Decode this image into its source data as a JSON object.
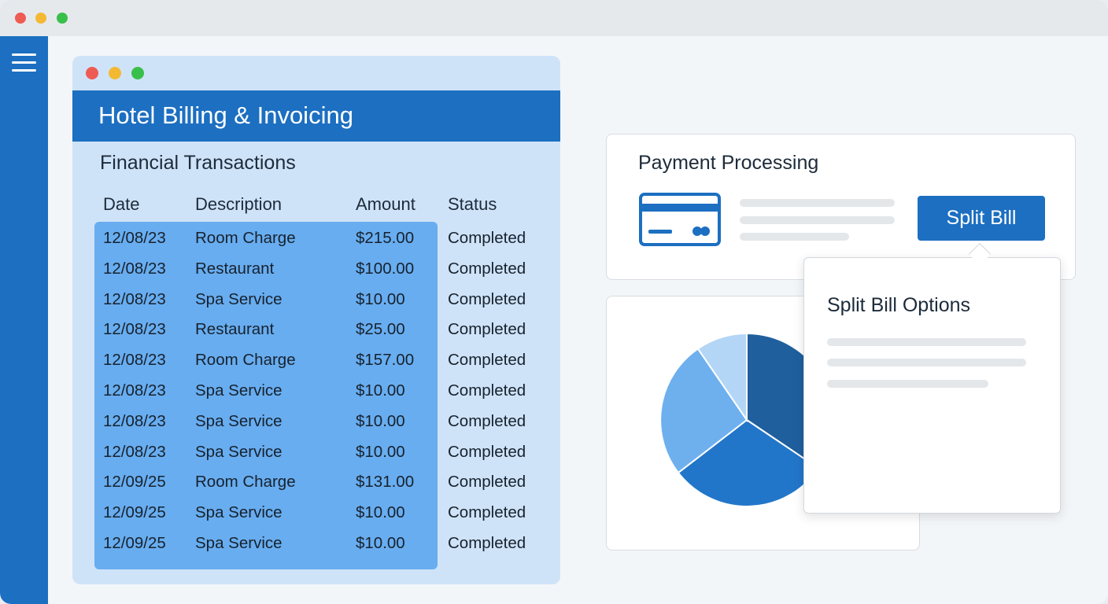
{
  "billing": {
    "title": "Hotel Billing & Invoicing",
    "section_title": "Financial Transactions",
    "columns": [
      "Date",
      "Description",
      "Amount",
      "Status"
    ],
    "rows": [
      {
        "date": "12/08/23",
        "description": "Room Charge",
        "amount": "$215.00",
        "status": "Completed"
      },
      {
        "date": "12/08/23",
        "description": "Restaurant",
        "amount": "$100.00",
        "status": "Completed"
      },
      {
        "date": "12/08/23",
        "description": "Spa Service",
        "amount": "$10.00",
        "status": "Completed"
      },
      {
        "date": "12/08/23",
        "description": "Restaurant",
        "amount": "$25.00",
        "status": "Completed"
      },
      {
        "date": "12/08/23",
        "description": "Room Charge",
        "amount": "$157.00",
        "status": "Completed"
      },
      {
        "date": "12/08/23",
        "description": "Spa Service",
        "amount": "$10.00",
        "status": "Completed"
      },
      {
        "date": "12/08/23",
        "description": "Spa Service",
        "amount": "$10.00",
        "status": "Completed"
      },
      {
        "date": "12/08/23",
        "description": "Spa Service",
        "amount": "$10.00",
        "status": "Completed"
      },
      {
        "date": "12/09/25",
        "description": "Room Charge",
        "amount": "$131.00",
        "status": "Completed"
      },
      {
        "date": "12/09/25",
        "description": "Spa Service",
        "amount": "$10.00",
        "status": "Completed"
      },
      {
        "date": "12/09/25",
        "description": "Spa Service",
        "amount": "$10.00",
        "status": "Completed"
      }
    ]
  },
  "payment": {
    "title": "Payment Processing",
    "split_button_label": "Split Bill",
    "icon": "credit-card-icon"
  },
  "popover": {
    "title": "Split Bill Options"
  },
  "sidebar": {
    "menu_icon": "hamburger-menu-icon"
  },
  "colors": {
    "primary": "#1c6fc1",
    "selection": "#68adf0",
    "panel": "#cfe3f8",
    "pie": [
      "#1f5f9e",
      "#2276c9",
      "#6eb0ee",
      "#b3d6f6"
    ]
  }
}
